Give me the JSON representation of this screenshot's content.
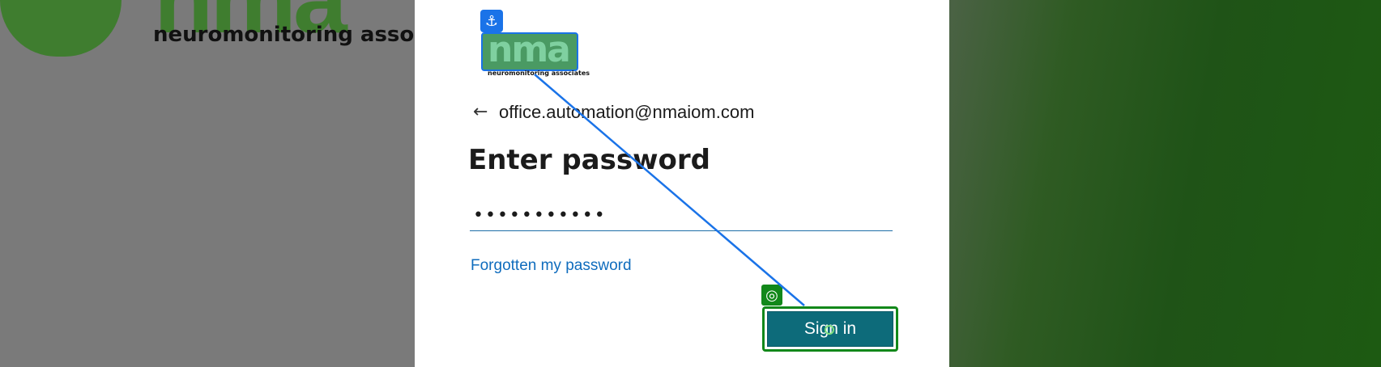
{
  "background": {
    "brand_tagline": "neuromonitoring associ",
    "brand_wordmark": "nma"
  },
  "card": {
    "logo_text": "nma",
    "logo_tagline": "neuromonitoring associates",
    "back_icon": "arrow-left-icon",
    "identity_email": "office.automation@nmaiom.com",
    "title": "Enter password",
    "password_value": "•••••••••••",
    "forgot_link": "Forgotten my password",
    "signin_button": "Sign in"
  },
  "annotations": {
    "anchor_icon": "⚓",
    "target_icon": "◎"
  },
  "colors": {
    "accent_blue": "#1a73e8",
    "accent_green": "#12881a",
    "button_teal": "#0d6b7a",
    "link_blue": "#0f6cbd"
  }
}
